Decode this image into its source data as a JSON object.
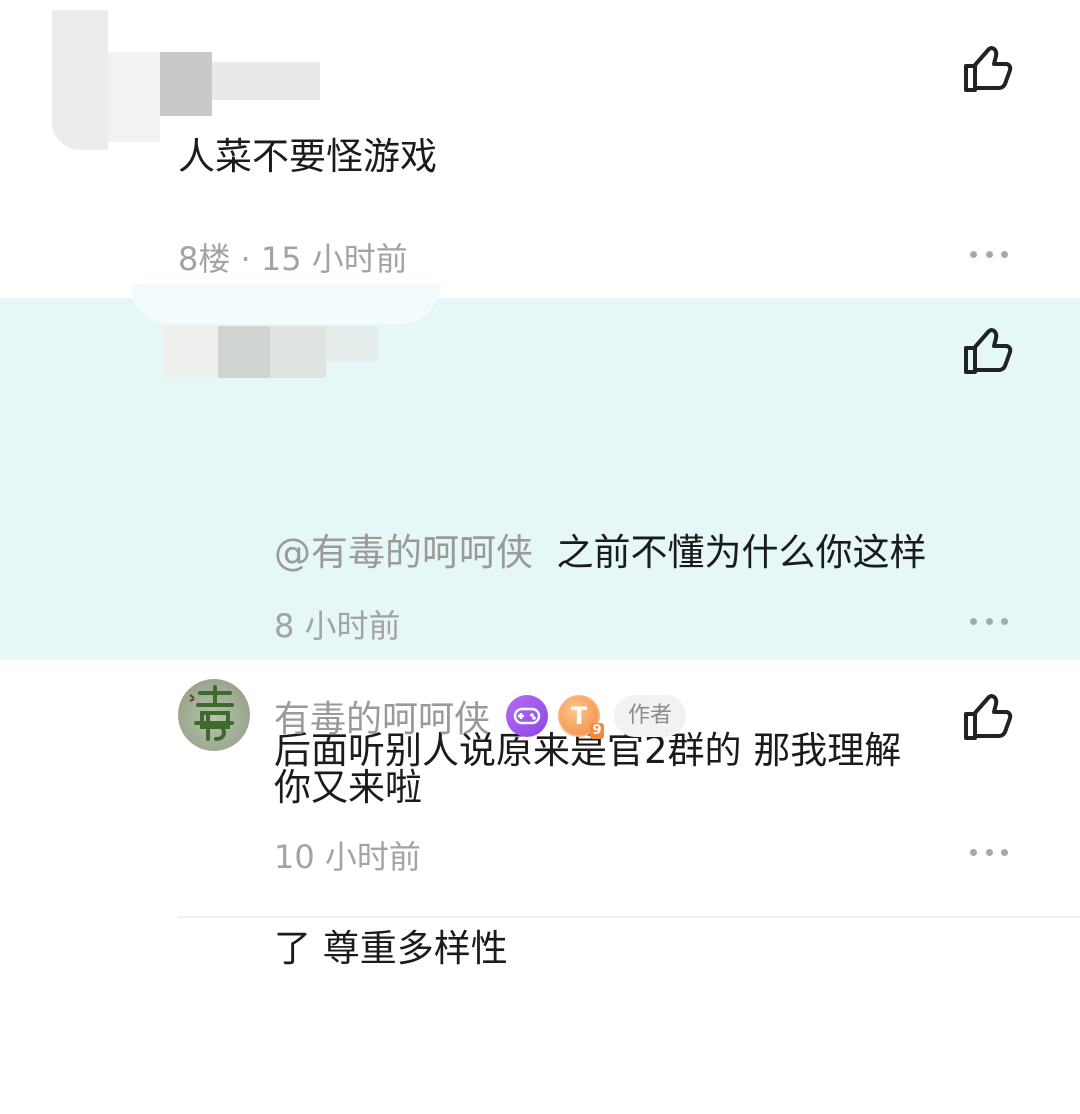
{
  "comments": [
    {
      "text": "人菜不要怪游戏",
      "meta": "8楼 · 15 小时前"
    }
  ],
  "reply": {
    "mention": "@有毒的呵呵侠",
    "text_line1": "之前不懂为什么你这样",
    "text_line2": "后面听别人说原来是官2群的 那我理解",
    "text_line3": "了 尊重多样性",
    "time": "8 小时前"
  },
  "author_reply": {
    "username": "有毒的呵呵侠",
    "badge_t": "T",
    "badge_level": "9",
    "author_tag": "作者",
    "text": "你又来啦",
    "time": "10 小时前"
  },
  "icons": {
    "like": "thumbs-up-icon",
    "more": "more-dots-icon",
    "game_badge": "gamepad-icon"
  },
  "colors": {
    "reply_background": "#e6f7f8",
    "meta_text": "#a3a3a3",
    "game_badge": "#9b55ea",
    "level_badge": "#f08a3e"
  }
}
